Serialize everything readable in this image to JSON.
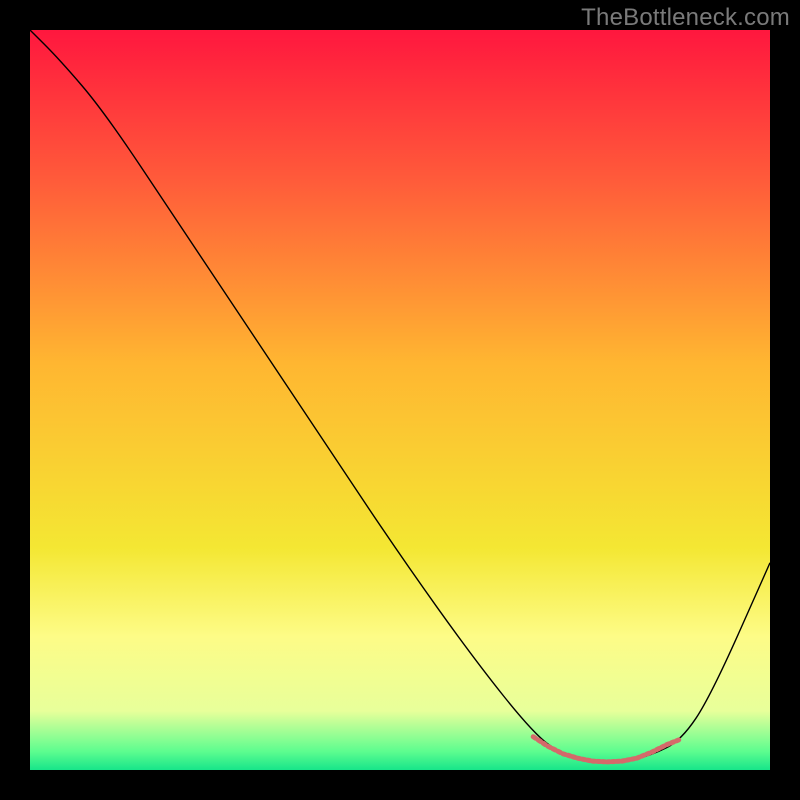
{
  "watermark": "TheBottleneck.com",
  "chart_data": {
    "type": "line",
    "title": "",
    "xlabel": "",
    "ylabel": "",
    "xlim": [
      0,
      100
    ],
    "ylim": [
      0,
      100
    ],
    "grid": false,
    "legend": false,
    "background": {
      "style": "vertical-gradient",
      "stops": [
        {
          "offset": 0.0,
          "color": "#ff173e"
        },
        {
          "offset": 0.2,
          "color": "#ff5a3a"
        },
        {
          "offset": 0.45,
          "color": "#ffb631"
        },
        {
          "offset": 0.7,
          "color": "#f4e733"
        },
        {
          "offset": 0.82,
          "color": "#fdfc87"
        },
        {
          "offset": 0.92,
          "color": "#e8ff9a"
        },
        {
          "offset": 0.975,
          "color": "#5dfd8f"
        },
        {
          "offset": 1.0,
          "color": "#17e58a"
        }
      ]
    },
    "series": [
      {
        "name": "curve",
        "color": "#000000",
        "width": 1.4,
        "x": [
          0,
          4,
          10,
          20,
          30,
          40,
          50,
          60,
          68,
          72,
          76,
          80,
          84,
          88,
          92,
          100
        ],
        "y": [
          100,
          96,
          89,
          74,
          59,
          44,
          29,
          15,
          5,
          2,
          1,
          1,
          2,
          4,
          10,
          28
        ]
      },
      {
        "name": "band",
        "style": "dotted",
        "color": "#d46a6a",
        "width": 5,
        "x": [
          68,
          70,
          72,
          74,
          76,
          78,
          80,
          82,
          84,
          86,
          88
        ],
        "y": [
          4.5,
          3.2,
          2.2,
          1.6,
          1.2,
          1.1,
          1.2,
          1.6,
          2.4,
          3.4,
          4.2
        ]
      }
    ]
  }
}
